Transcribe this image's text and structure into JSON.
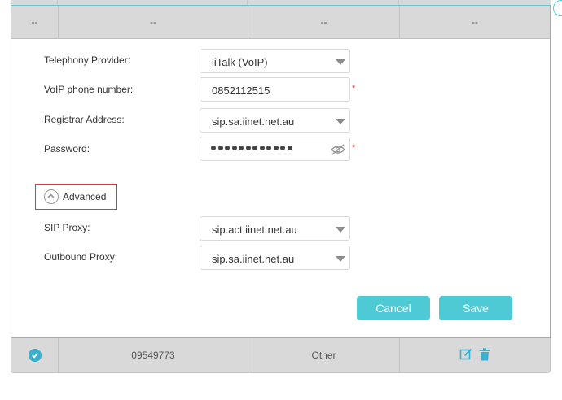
{
  "table": {
    "placeholder_row": {
      "cells": [
        "--",
        "--",
        "--",
        "--"
      ]
    },
    "saved_row": {
      "number": "09549773",
      "provider": "Other"
    }
  },
  "form": {
    "telephony_provider": {
      "label": "Telephony Provider:",
      "value": "iiTalk (VoIP)"
    },
    "voip_number": {
      "label": "VoIP phone number:",
      "value": "0852112515",
      "required": "*"
    },
    "registrar": {
      "label": "Registrar Address:",
      "value": "sip.sa.iinet.net.au"
    },
    "password": {
      "label": "Password:",
      "masked_length": 12,
      "required": "*"
    },
    "advanced": {
      "label": "Advanced"
    },
    "sip_proxy": {
      "label": "SIP Proxy:",
      "value": "sip.act.iinet.net.au"
    },
    "outbound_proxy": {
      "label": "Outbound Proxy:",
      "value": "sip.sa.iinet.net.au"
    }
  },
  "buttons": {
    "cancel": "Cancel",
    "save": "Save"
  },
  "icons": {
    "corner": "circle-icon",
    "eye": "eye-off-icon",
    "advanced": "chevron-up-circle-icon",
    "status": "check-circle-icon",
    "edit": "edit-icon",
    "delete": "trash-icon"
  },
  "colors": {
    "accent": "#4ecad4",
    "row_bg": "#d9d9d9",
    "required": "#e23b3b",
    "highlight_border": "#d23b3b"
  }
}
